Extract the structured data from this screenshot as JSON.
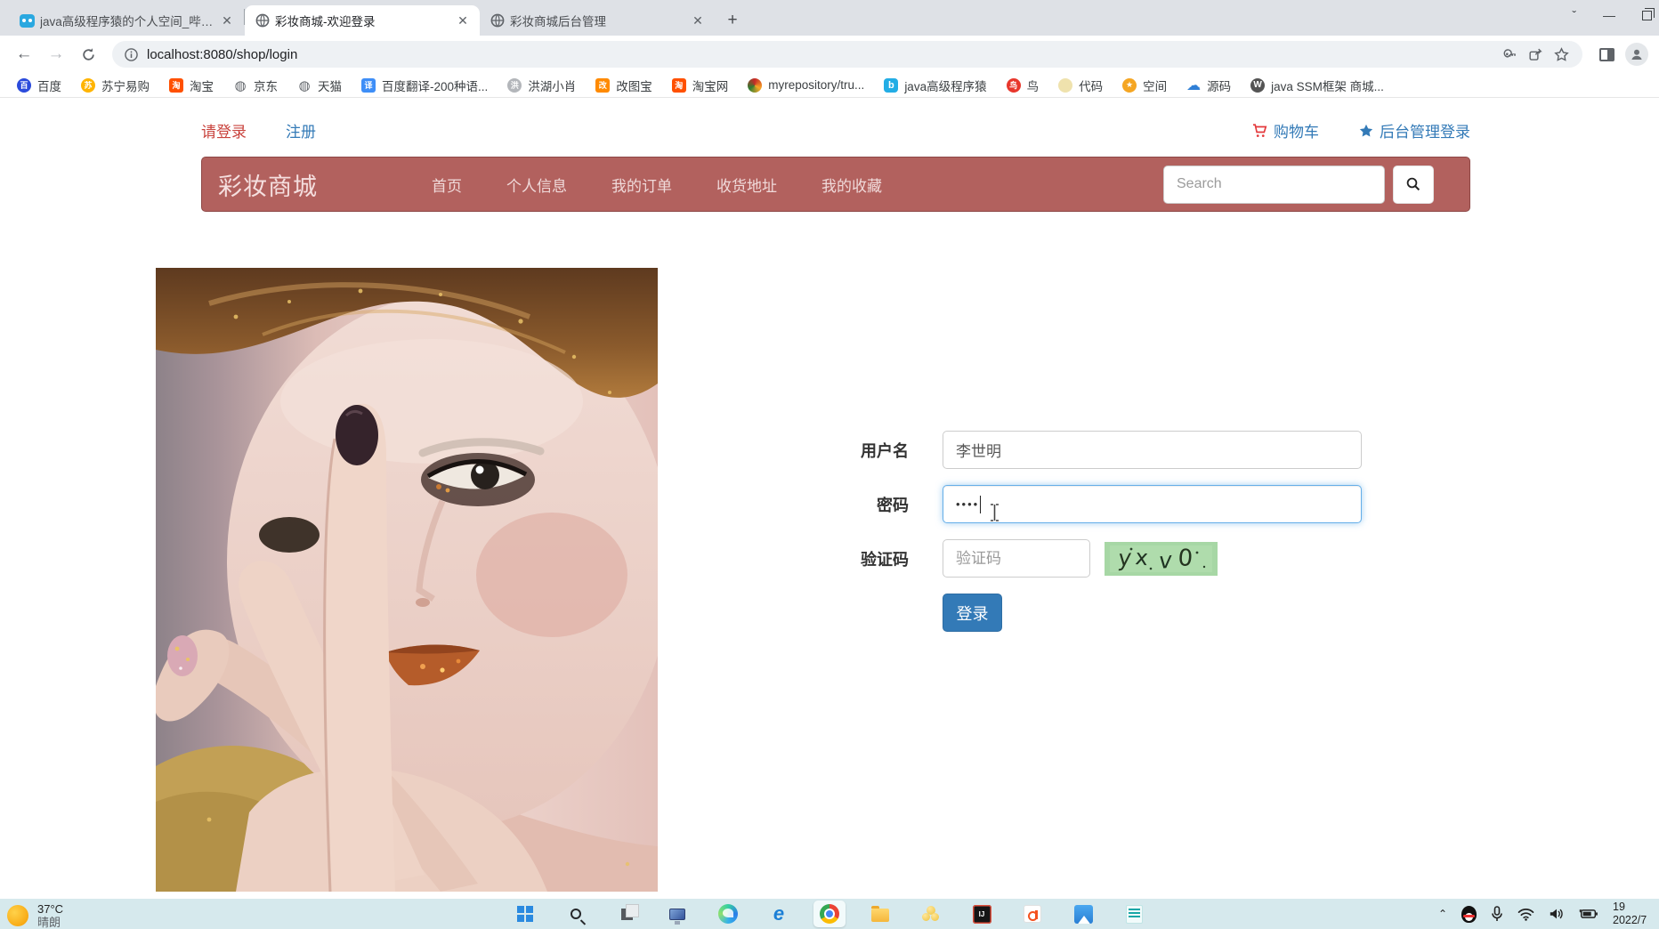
{
  "theme": {
    "navbar-bg": "#b2615e",
    "navbar-border": "#8e4846",
    "red": "#c9433d",
    "blue": "#337ab7",
    "focus": "#66afe9",
    "captcha-bg": "#a7d7a5",
    "btn-blue": "#337ab7",
    "taskbar-bg": "#d6e9ed"
  },
  "browser": {
    "tabs": [
      {
        "title": "java高级程序猿的个人空间_哔哩...",
        "icon": "bilibili"
      },
      {
        "title": "彩妆商城-欢迎登录",
        "icon": "globe"
      },
      {
        "title": "彩妆商城后台管理",
        "icon": "globe"
      }
    ],
    "new_tab_label": "+",
    "url": "localhost:8080/shop/login",
    "bookmarks": [
      {
        "label": "百度",
        "glyph": "百",
        "bg": "#2b4bdc",
        "fg": "#fff",
        "rad": "50%",
        "fs": "9px"
      },
      {
        "label": "苏宁易购",
        "glyph": "苏",
        "bg": "#ffb400",
        "fg": "#fff",
        "rad": "50%",
        "fs": "9px"
      },
      {
        "label": "淘宝",
        "glyph": "淘",
        "bg": "#ff5000",
        "fg": "#fff",
        "rad": "3px",
        "fs": "9px"
      },
      {
        "label": "京东",
        "glyph": "◍",
        "bg": "transparent",
        "fg": "#5f6368",
        "rad": "0",
        "fs": "15px"
      },
      {
        "label": "天猫",
        "glyph": "◍",
        "bg": "transparent",
        "fg": "#5f6368",
        "rad": "0",
        "fs": "15px"
      },
      {
        "label": "百度翻译-200种语...",
        "glyph": "译",
        "bg": "#3e8ef7",
        "fg": "#fff",
        "rad": "3px",
        "fs": "9px"
      },
      {
        "label": "洪湖小肖",
        "glyph": "洪",
        "bg": "#b3b6ba",
        "fg": "#fff",
        "rad": "50%",
        "fs": "9px"
      },
      {
        "label": "改图宝",
        "glyph": "改",
        "bg": "#ff8a00",
        "fg": "#fff",
        "rad": "3px",
        "fs": "9px"
      },
      {
        "label": "淘宝网",
        "glyph": "淘",
        "bg": "#ff5000",
        "fg": "#fff",
        "rad": "3px",
        "fs": "9px"
      },
      {
        "label": "myrepository/tru...",
        "glyph": "",
        "bg": "conic-gradient(#c62828,#f9a825,#2e7d32,#c62828)",
        "fg": "#fff",
        "rad": "50%",
        "fs": "9px"
      },
      {
        "label": "java高级程序猿",
        "glyph": "b",
        "bg": "#23ade5",
        "fg": "#fff",
        "rad": "4px",
        "fs": "11px"
      },
      {
        "label": "鸟",
        "glyph": "鸟",
        "bg": "#e8372c",
        "fg": "#fff",
        "rad": "50%",
        "fs": "9px"
      },
      {
        "label": "代码",
        "glyph": "",
        "bg": "#efe2ad",
        "fg": "#fff",
        "rad": "50%",
        "fs": "9px"
      },
      {
        "label": "空间",
        "glyph": "★",
        "bg": "#f5a623",
        "fg": "#fff",
        "rad": "50%",
        "fs": "9px"
      },
      {
        "label": "源码",
        "glyph": "☁",
        "bg": "transparent",
        "fg": "#2f7fd6",
        "rad": "0",
        "fs": "16px"
      },
      {
        "label": "java SSM框架 商城...",
        "glyph": "W",
        "bg": "#545454",
        "fg": "#fff",
        "rad": "50%",
        "fs": "10px"
      }
    ]
  },
  "page": {
    "topbar": {
      "login": "请登录",
      "register": "注册",
      "cart": "购物车",
      "admin": "后台管理登录"
    },
    "navbar": {
      "brand": "彩妆商城",
      "items": [
        "首页",
        "个人信息",
        "我的订单",
        "收货地址",
        "我的收藏"
      ],
      "search_placeholder": "Search"
    },
    "form": {
      "username": {
        "label": "用户名",
        "value": "李世明"
      },
      "password": {
        "label": "密码",
        "value": "••••"
      },
      "captcha": {
        "label": "验证码",
        "placeholder": "验证码",
        "image_text": "yx v0"
      },
      "submit_label": "登录"
    }
  },
  "taskbar": {
    "weather": {
      "temp": "37°C",
      "cond": "晴朗"
    },
    "clock": {
      "time": "19",
      "date": "2022/7"
    },
    "app_icons": [
      "start",
      "search",
      "task-view",
      "this-pc",
      "edge",
      "internet-explorer",
      "chrome",
      "file-explorer",
      "app-cluster",
      "intellij-idea",
      "docs",
      "photos",
      "notepad"
    ],
    "tray_icons": [
      "tray-expand",
      "qq",
      "microphone",
      "wifi",
      "volume",
      "battery"
    ]
  }
}
